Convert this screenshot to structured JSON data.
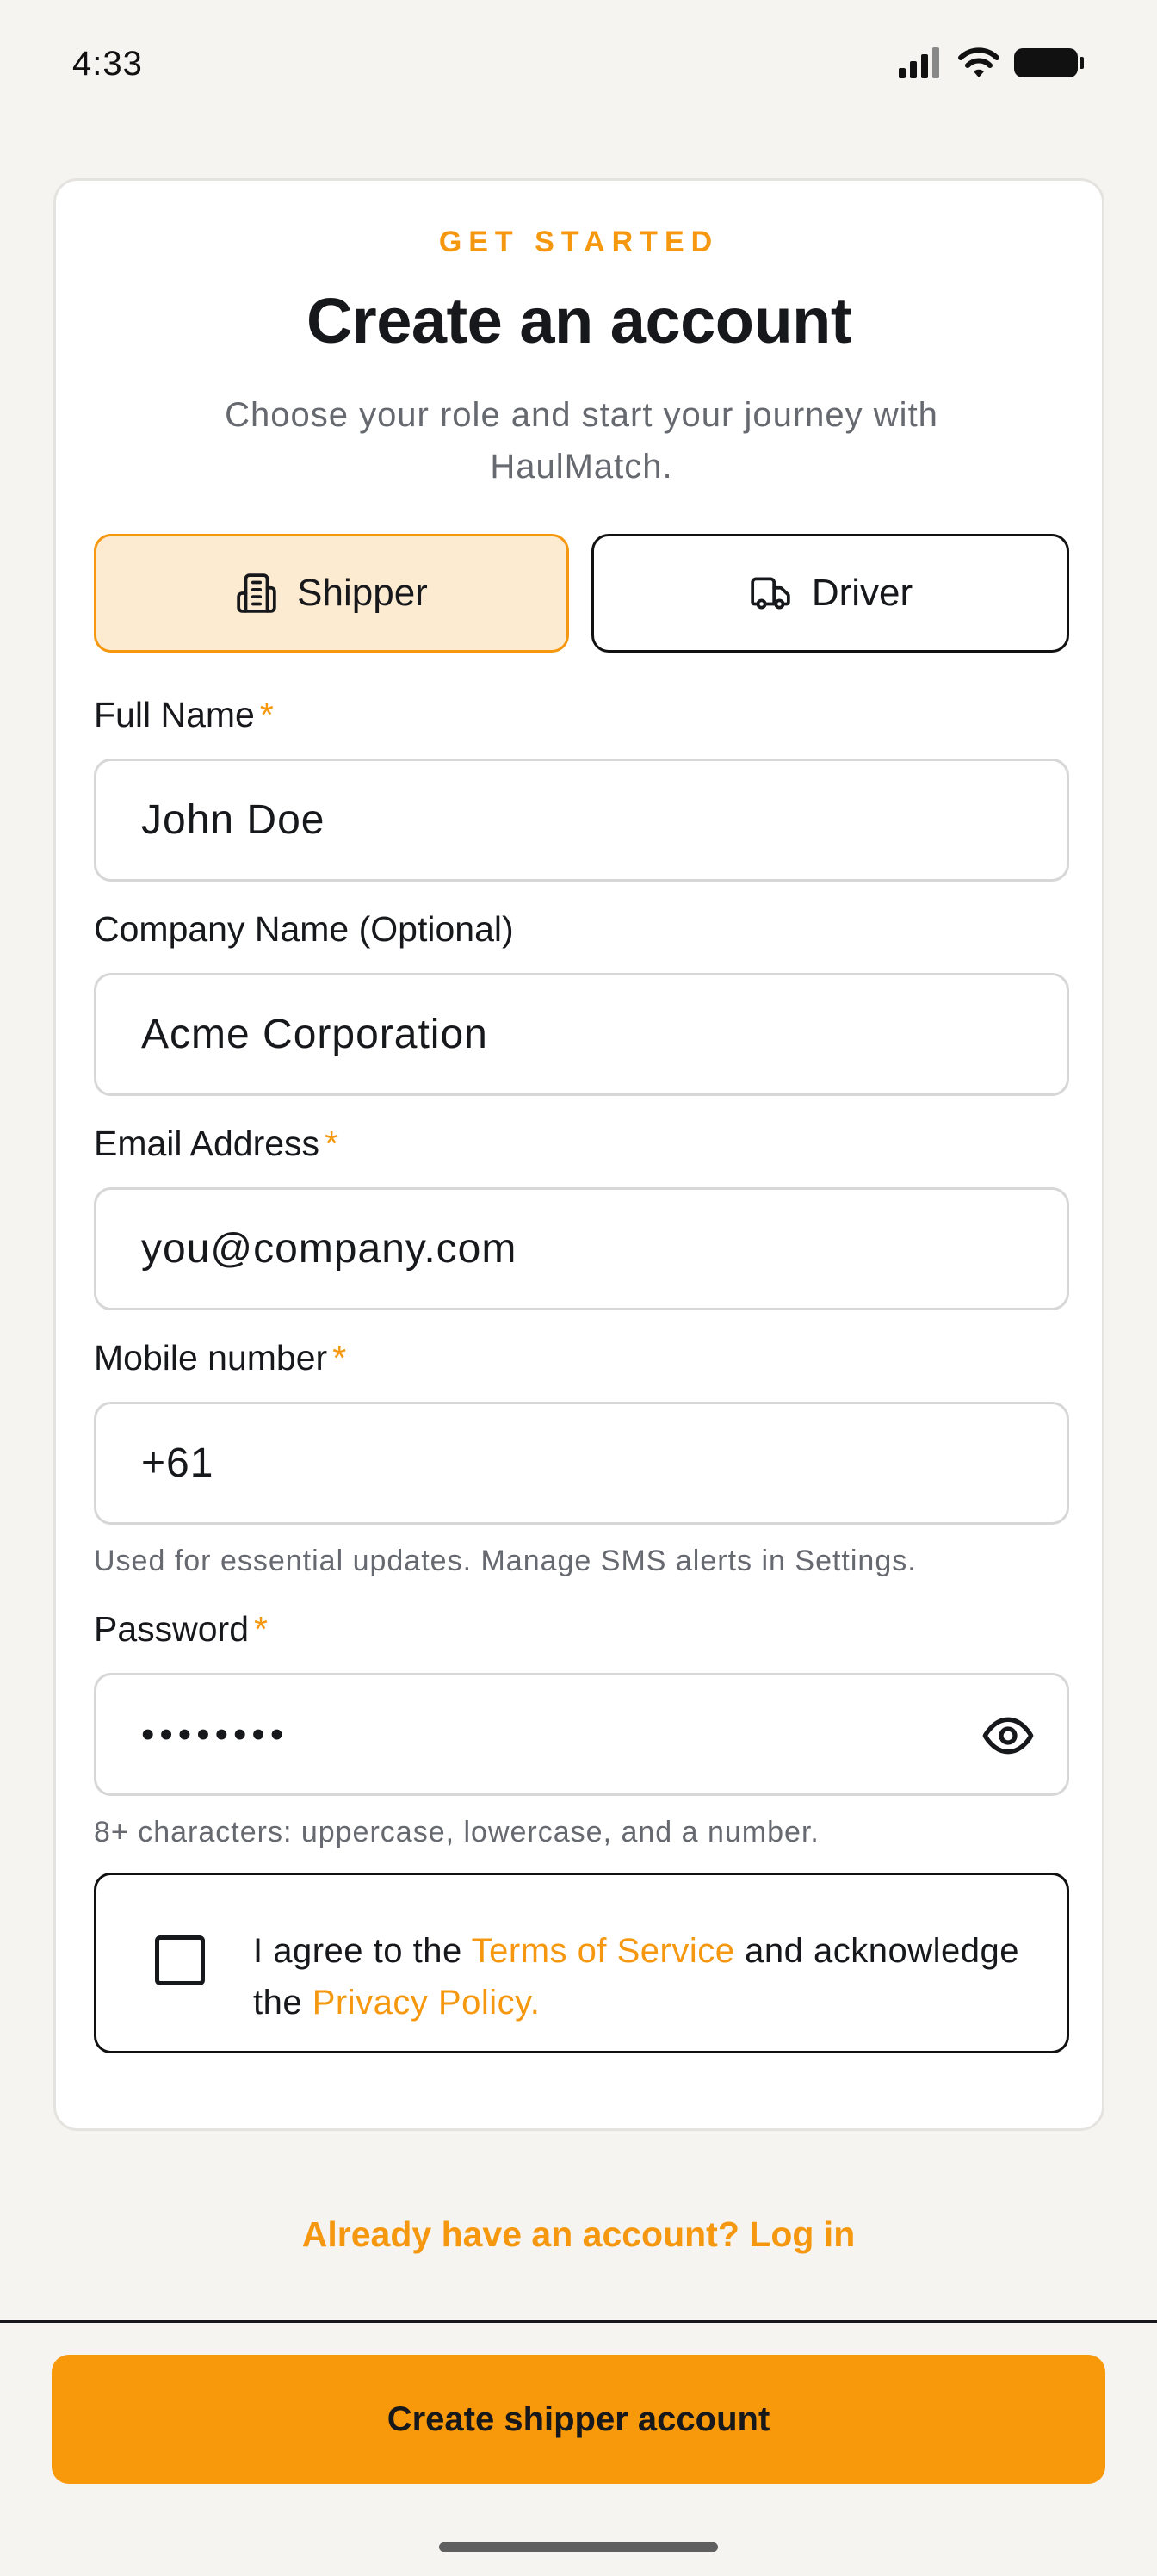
{
  "status": {
    "time": "4:33"
  },
  "header": {
    "eyebrow": "GET STARTED",
    "title": "Create an account",
    "subtitle": "Choose your role and start your journey with HaulMatch."
  },
  "roles": {
    "shipper": {
      "label": "Shipper",
      "icon": "building-icon",
      "selected": true
    },
    "driver": {
      "label": "Driver",
      "icon": "truck-icon",
      "selected": false
    }
  },
  "form": {
    "full_name": {
      "label": "Full Name",
      "required": "*",
      "placeholder": "John Doe"
    },
    "company": {
      "label": "Company Name (Optional)",
      "placeholder": "Acme Corporation"
    },
    "email": {
      "label": "Email Address",
      "required": "*",
      "placeholder": "you@company.com"
    },
    "mobile": {
      "label": "Mobile number",
      "required": "*",
      "value": "+61",
      "hint": "Used for essential updates. Manage SMS alerts in Settings."
    },
    "password": {
      "label": "Password",
      "required": "*",
      "value": "••••••••",
      "hint": "8+ characters: uppercase, lowercase, and a number."
    }
  },
  "terms": {
    "prefix": "I agree to the ",
    "tos": "Terms of Service",
    "middle": " and acknowledge the ",
    "privacy": "Privacy Policy.",
    "checked": false
  },
  "login_link": "Already have an account? Log in",
  "cta": {
    "label": "Create shipper account"
  },
  "colors": {
    "accent": "#f5980f",
    "selected_bg": "#fdebd1",
    "text": "#17181c",
    "muted": "#66696f"
  }
}
